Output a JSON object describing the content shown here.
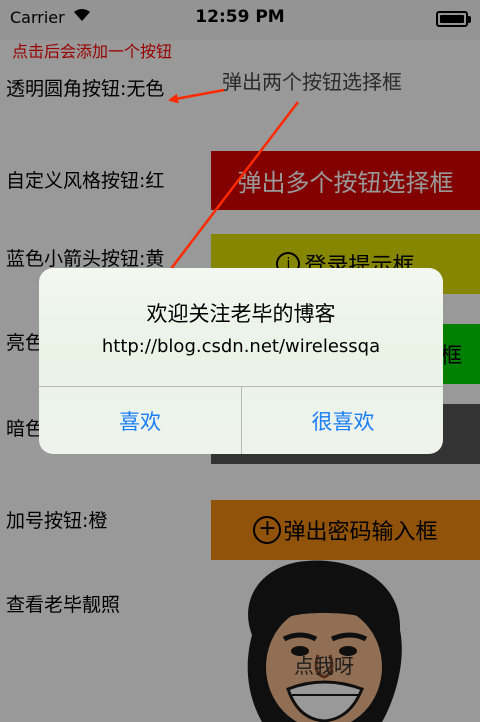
{
  "status_bar": {
    "carrier": "Carrier",
    "time": "12:59 PM"
  },
  "hint_text": "点击后会添加一个按钮",
  "rows": [
    {
      "label": "透明圆角按钮:无色",
      "button": "弹出两个按钮选择框"
    },
    {
      "label": "自定义风格按钮:红",
      "button": "弹出多个按钮选择框"
    },
    {
      "label": "蓝色小箭头按钮:黄",
      "button": "登录提示框"
    },
    {
      "label": "亮色",
      "button": "框"
    },
    {
      "label": "暗色",
      "button": ""
    },
    {
      "label": "加号按钮:橙",
      "button": "弹出密码输入框"
    },
    {
      "label": "查看老毕靓照",
      "button": "点我呀"
    }
  ],
  "alert": {
    "title": "欢迎关注老毕的博客",
    "message": "http://blog.csdn.net/wirelessqa",
    "buttons": [
      "喜欢",
      "很喜欢"
    ]
  },
  "colors": {
    "red_button": "#d90000",
    "yellow_button": "#e0e000",
    "green_button": "#00d400",
    "dark_button": "#555555",
    "orange_button": "#f08a10",
    "alert_button_text": "#1a7ef5",
    "annotation": "#ff2a00"
  },
  "icons": [
    "wifi-icon",
    "battery-icon",
    "info-icon",
    "add-circle-icon"
  ]
}
